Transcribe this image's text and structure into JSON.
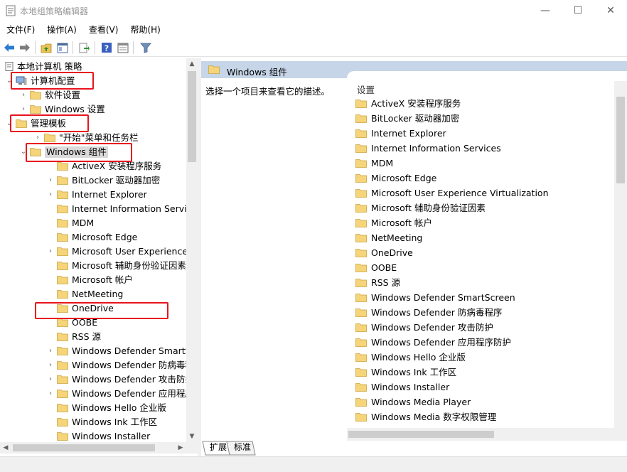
{
  "window": {
    "title": "本地组策略编辑器",
    "minimize": "—",
    "maximize": "☐",
    "close": "✕"
  },
  "menu": [
    "文件(F)",
    "操作(A)",
    "查看(V)",
    "帮助(H)"
  ],
  "toolbar": {
    "icons": [
      "back-arrow-icon",
      "forward-arrow-icon",
      "up-folder-icon",
      "show-hide-tree-icon",
      "export-list-icon",
      "help-icon",
      "properties-icon",
      "filter-icon"
    ]
  },
  "tree": {
    "items": [
      {
        "label": "本地计算机 策略",
        "level": 0,
        "expanded": true,
        "arrow": "",
        "kind": "policy"
      },
      {
        "label": "计算机配置",
        "level": 1,
        "expanded": true,
        "arrow": "⌄",
        "kind": "computer"
      },
      {
        "label": "软件设置",
        "level": 2,
        "arrow": "›",
        "kind": "folder"
      },
      {
        "label": "Windows 设置",
        "level": 2,
        "arrow": "›",
        "kind": "folder"
      },
      {
        "label": "管理模板",
        "level": 1.5,
        "expanded": true,
        "arrow": "⌄",
        "kind": "folder"
      },
      {
        "label": "\"开始\"菜单和任务栏",
        "level": 3,
        "arrow": "›",
        "kind": "folder"
      },
      {
        "label": "Windows 组件",
        "level": 2.5,
        "expanded": true,
        "arrow": "⌄",
        "kind": "folder",
        "selected": true
      },
      {
        "label": "ActiveX 安装程序服务",
        "level": 4,
        "arrow": "",
        "kind": "folder"
      },
      {
        "label": "BitLocker 驱动器加密",
        "level": 4,
        "arrow": "›",
        "kind": "folder"
      },
      {
        "label": "Internet Explorer",
        "level": 4,
        "arrow": "›",
        "kind": "folder"
      },
      {
        "label": "Internet Information Services",
        "level": 4,
        "arrow": "",
        "kind": "folder"
      },
      {
        "label": "MDM",
        "level": 4,
        "arrow": "",
        "kind": "folder"
      },
      {
        "label": "Microsoft Edge",
        "level": 4,
        "arrow": "",
        "kind": "folder"
      },
      {
        "label": "Microsoft User Experience Virtualization",
        "level": 4,
        "arrow": "›",
        "kind": "folder"
      },
      {
        "label": "Microsoft 辅助身份验证因素",
        "level": 4,
        "arrow": "",
        "kind": "folder"
      },
      {
        "label": "Microsoft 帐户",
        "level": 4,
        "arrow": "",
        "kind": "folder"
      },
      {
        "label": "NetMeeting",
        "level": 4,
        "arrow": "",
        "kind": "folder"
      },
      {
        "label": "OneDrive",
        "level": 4,
        "arrow": "",
        "kind": "folder"
      },
      {
        "label": "OOBE",
        "level": 4,
        "arrow": "",
        "kind": "folder"
      },
      {
        "label": "RSS 源",
        "level": 4,
        "arrow": "",
        "kind": "folder"
      },
      {
        "label": "Windows Defender SmartScreen",
        "level": 4,
        "arrow": "›",
        "kind": "folder"
      },
      {
        "label": "Windows Defender 防病毒程序",
        "level": 4,
        "arrow": "›",
        "kind": "folder"
      },
      {
        "label": "Windows Defender 攻击防护",
        "level": 4,
        "arrow": "›",
        "kind": "folder"
      },
      {
        "label": "Windows Defender 应用程序防护",
        "level": 4,
        "arrow": "›",
        "kind": "folder"
      },
      {
        "label": "Windows Hello 企业版",
        "level": 4,
        "arrow": "",
        "kind": "folder"
      },
      {
        "label": "Windows Ink 工作区",
        "level": 4,
        "arrow": "",
        "kind": "folder"
      },
      {
        "label": "Windows Installer",
        "level": 4,
        "arrow": "",
        "kind": "folder"
      }
    ]
  },
  "right": {
    "header": "Windows 组件",
    "description": "选择一个项目来查看它的描述。",
    "column_header": "设置",
    "settings": [
      "ActiveX 安装程序服务",
      "BitLocker 驱动器加密",
      "Internet Explorer",
      "Internet Information Services",
      "MDM",
      "Microsoft Edge",
      "Microsoft User Experience Virtualization",
      "Microsoft 辅助身份验证因素",
      "Microsoft 帐户",
      "NetMeeting",
      "OneDrive",
      "OOBE",
      "RSS 源",
      "Windows Defender SmartScreen",
      "Windows Defender 防病毒程序",
      "Windows Defender 攻击防护",
      "Windows Defender 应用程序防护",
      "Windows Hello 企业版",
      "Windows Ink 工作区",
      "Windows Installer",
      "Windows Media Player",
      "Windows Media 数字权限管理"
    ]
  },
  "tabs": [
    "扩展",
    "标准"
  ],
  "colors": {
    "header_band": "#c6d5e8",
    "highlight_box": "#e8141d",
    "folder": "#f5d47a"
  }
}
